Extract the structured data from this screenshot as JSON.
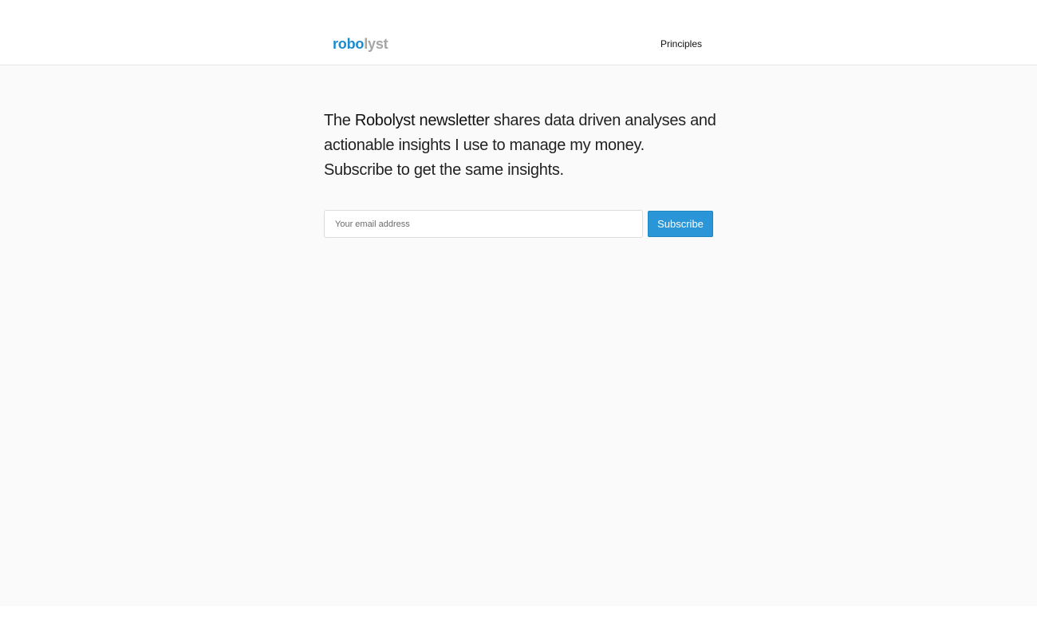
{
  "header": {
    "logo_part1": "robo",
    "logo_part2": "lyst",
    "nav_principles": "Principles"
  },
  "intro": {
    "text_before": "The ",
    "bold": "Robolyst newsletter",
    "text_after": " shares data driven analyses and actionable insights I use to manage my money. Subscribe to get the same insights."
  },
  "subscribe_form": {
    "email_placeholder": "Your email address",
    "email_value": "",
    "button_label": "Subscribe"
  },
  "colors": {
    "brand_blue": "#1a8bd0",
    "logo_gray": "#a5a5a5",
    "button_blue": "#2a96d8",
    "page_background": "#fafafa"
  }
}
